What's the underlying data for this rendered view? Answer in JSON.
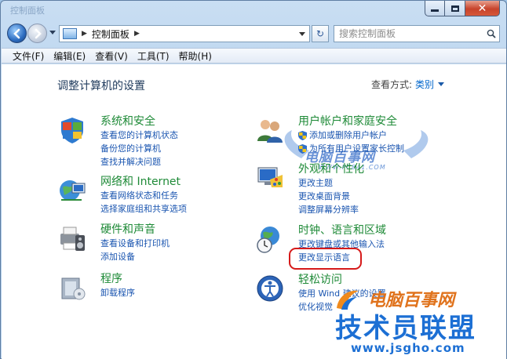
{
  "window": {
    "title_ghost": "控制面板"
  },
  "address_bar": {
    "path": "控制面板"
  },
  "search": {
    "placeholder": "搜索控制面板"
  },
  "menu": [
    "文件(F)",
    "编辑(E)",
    "查看(V)",
    "工具(T)",
    "帮助(H)"
  ],
  "header": {
    "title": "调整计算机的设置",
    "view_by_label": "查看方式:",
    "view_by_value": "类别"
  },
  "categories": [
    {
      "title": "系统和安全",
      "icon": "shield-flag-icon",
      "links": [
        "查看您的计算机状态",
        "备份您的计算机",
        "查找并解决问题"
      ]
    },
    {
      "title": "网络和 Internet",
      "icon": "network-globe-icon",
      "links": [
        "查看网络状态和任务",
        "选择家庭组和共享选项"
      ]
    },
    {
      "title": "硬件和声音",
      "icon": "printer-speaker-icon",
      "links": [
        "查看设备和打印机",
        "添加设备"
      ]
    },
    {
      "title": "程序",
      "icon": "programs-box-icon",
      "links": [
        "卸载程序"
      ]
    },
    {
      "title": "用户帐户和家庭安全",
      "icon": "users-icon",
      "links": [
        "添加或删除用户帐户",
        "为所有用户设置家长控制"
      ]
    },
    {
      "title": "外观和个性化",
      "icon": "monitor-palette-icon",
      "links": [
        "更改主题",
        "更改桌面背景",
        "调整屏幕分辨率"
      ]
    },
    {
      "title": "时钟、语言和区域",
      "icon": "globe-clock-icon",
      "links": [
        "更改键盘或其他输入法",
        "更改显示语言"
      ]
    },
    {
      "title": "轻松访问",
      "icon": "ease-of-access-icon",
      "links": [
        "使用 Wind  建议的设置",
        "优化视觉"
      ]
    }
  ],
  "watermarks": {
    "top_cn": "电脑百事网",
    "top_url": "WWW.PC841.COM",
    "bottom_cn": "电脑百事网",
    "bottom_big": "技术员联盟",
    "bottom_url": "www.jsgho.com"
  },
  "colors": {
    "category_title": "#1e8a37",
    "link": "#1a55b0",
    "highlight_box": "#d61a1a",
    "window_chrome": "#aac9e8"
  }
}
